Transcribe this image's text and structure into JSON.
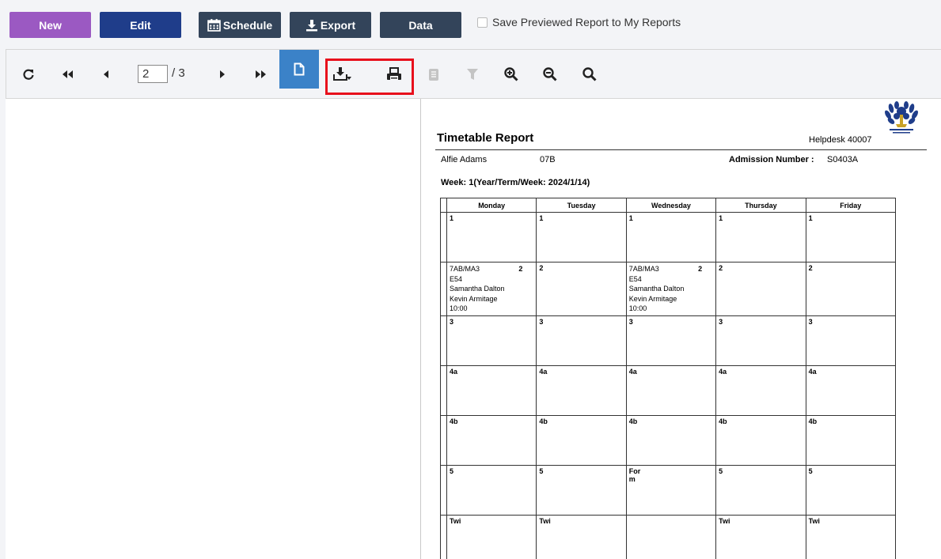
{
  "topbar": {
    "new_label": "New",
    "edit_label": "Edit",
    "schedule_label": "Schedule",
    "export_label": "Export",
    "data_label": "Data",
    "save_checkbox_label": "Save Previewed Report to My Reports"
  },
  "toolbar": {
    "current_page": "2",
    "total_pages": "/ 3"
  },
  "report": {
    "title": "Timetable Report",
    "helpdesk": "Helpdesk 40007",
    "student_name": "Alfie Adams",
    "class": "07B",
    "admission_label": "Admission Number :",
    "admission_value": "S0403A",
    "week": "Week: 1(Year/Term/Week: 2024/1/14)",
    "days": [
      "Monday",
      "Tuesday",
      "Wednesday",
      "Thursday",
      "Friday"
    ],
    "rows": [
      [
        "1",
        "1",
        "1",
        "1",
        "1"
      ],
      [
        "2",
        "2",
        "2",
        "2",
        "2"
      ],
      [
        "3",
        "3",
        "3",
        "3",
        "3"
      ],
      [
        "4a",
        "4a",
        "4a",
        "4a",
        "4a"
      ],
      [
        "4b",
        "4b",
        "4b",
        "4b",
        "4b"
      ],
      [
        "5",
        "5",
        "For\nm",
        "5",
        "5"
      ],
      [
        "Twi",
        "Twi",
        "",
        "Twi",
        "Twi"
      ]
    ],
    "lesson": {
      "code": "7AB/MA3",
      "period": "2",
      "room": "E54",
      "teacher1": "Samantha Dalton",
      "teacher2": "Kevin Armitage",
      "time": "10:00"
    }
  },
  "colors": {
    "new": "#9b59c2",
    "edit": "#1f3d8a",
    "dark_button": "#33445a",
    "active_tool": "#3b82c8",
    "highlight": "#e8101c"
  }
}
